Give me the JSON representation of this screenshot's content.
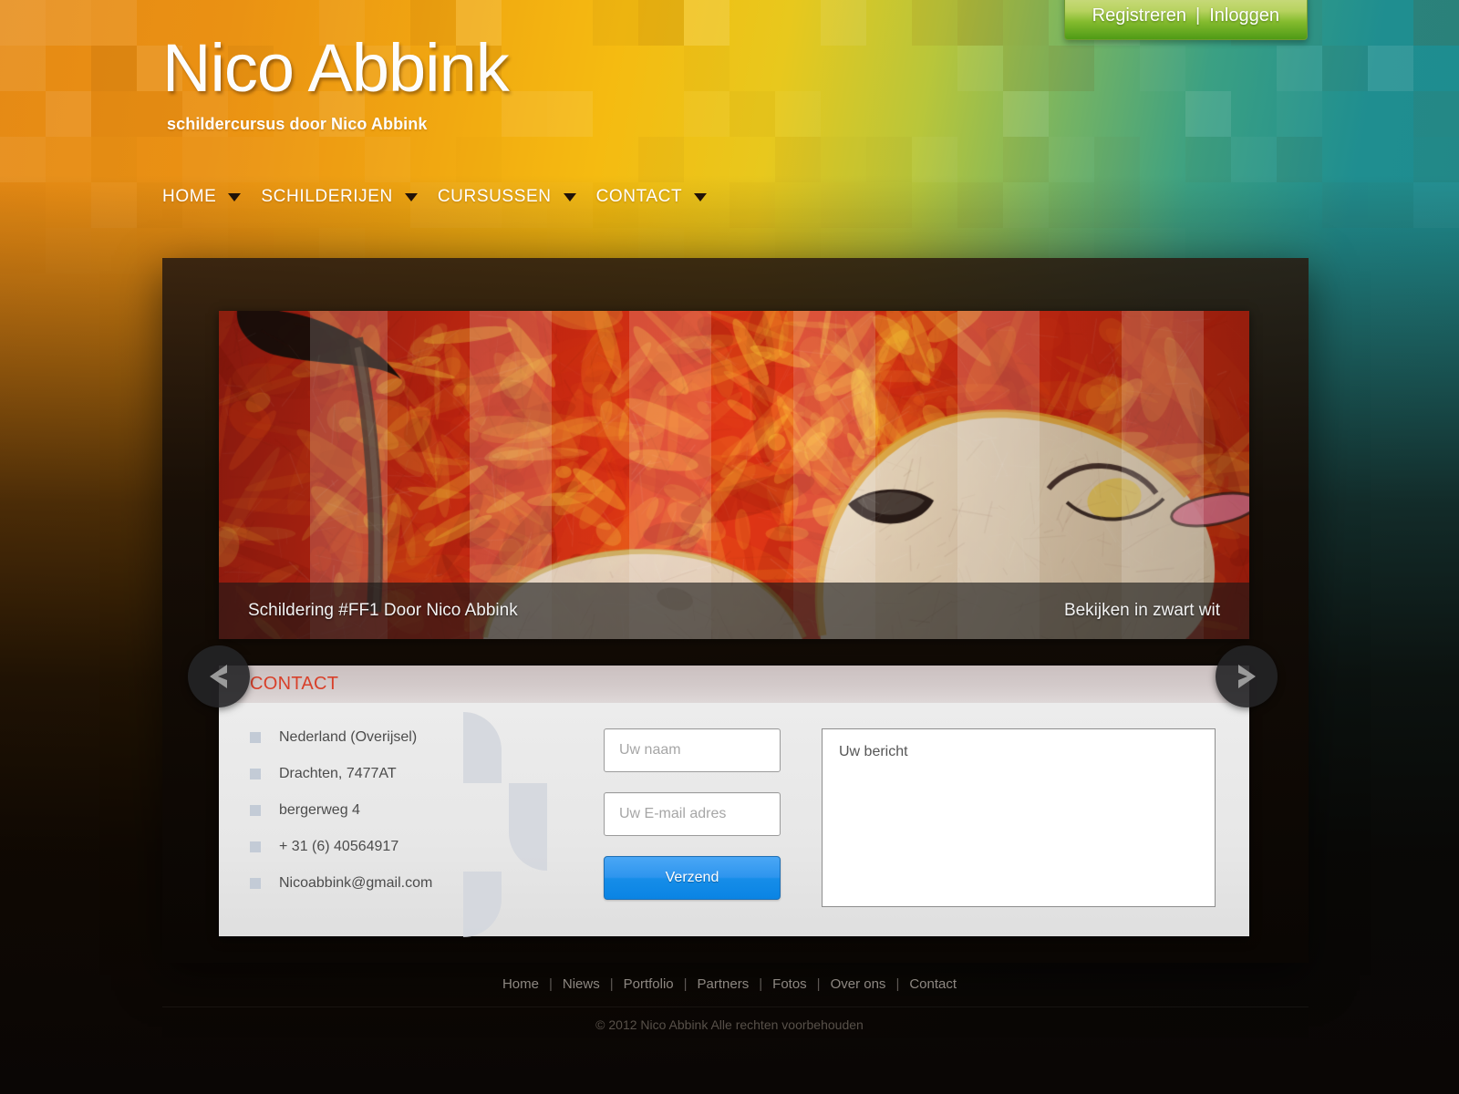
{
  "header": {
    "site_title": "Nico Abbink",
    "tagline": "schildercursus door Nico Abbink",
    "auth": {
      "register_label": "Registreren",
      "separator": "|",
      "login_label": "Inloggen",
      "bg_color": "#84bb2e"
    },
    "nav": [
      {
        "label": "HOME",
        "caret": "chevron-down-icon"
      },
      {
        "label": "SCHILDERIJEN",
        "caret": "chevron-down-icon"
      },
      {
        "label": "CURSUSSEN",
        "caret": "chevron-down-icon"
      },
      {
        "label": "CONTACT",
        "caret": "chevron-down-icon"
      }
    ]
  },
  "slider": {
    "prev_icon": "chevron-left-icon",
    "next_icon": "chevron-right-icon",
    "caption": "Schildering #FF1 Door Nico Abbink",
    "caption_link": "Bekijken in zwart wit"
  },
  "contact": {
    "title": "CONTACT",
    "title_color": "#d8402a",
    "info": [
      "Nederland (Overijsel)",
      "Drachten, 7477AT",
      "bergerweg 4",
      "+ 31 (6) 40564917",
      "Nicoabbink@gmail.com"
    ],
    "form": {
      "name_placeholder": "Uw naam",
      "email_placeholder": "Uw E-mail adres",
      "message_placeholder": "Uw bericht",
      "submit_label": "Verzend",
      "submit_color": "#2e95ee"
    }
  },
  "footer": {
    "links": [
      "Home",
      "Niews",
      "Portfolio",
      "Partners",
      "Fotos",
      "Over ons",
      "Contact"
    ],
    "separator": "|",
    "copyright": "© 2012  Nico Abbink Alle rechten voorbehouden"
  }
}
